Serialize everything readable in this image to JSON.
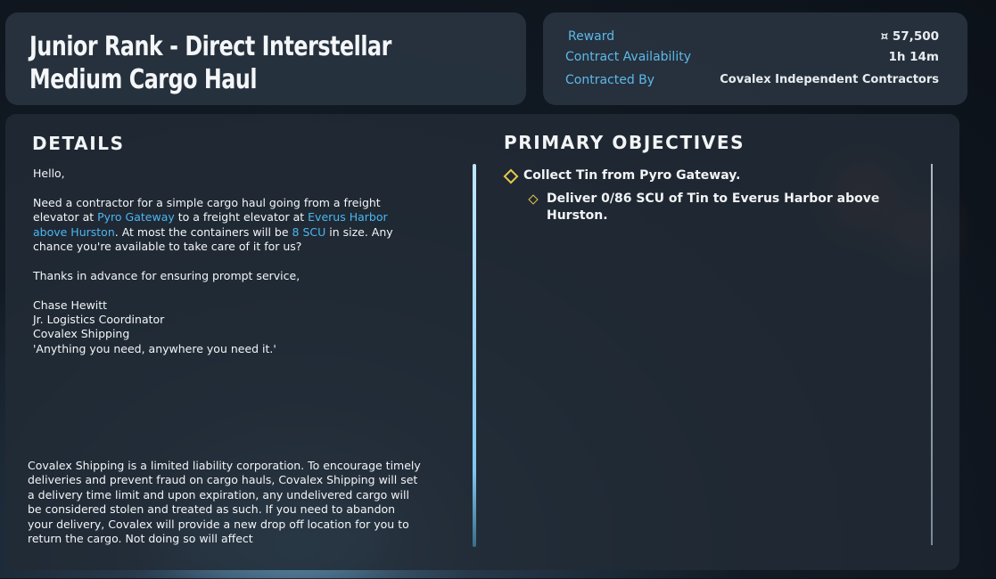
{
  "contract": {
    "title": "Junior Rank - Direct Interstellar Medium Cargo Haul"
  },
  "info": {
    "reward_label": "Reward",
    "reward_value": "¤ 57,500",
    "availability_label": "Contract Availability",
    "availability_value": "1h 14m",
    "contracted_by_label": "Contracted By",
    "contracted_by_value": "Covalex Independent Contractors"
  },
  "details": {
    "heading": "DETAILS",
    "greeting": "Hello,",
    "body_1": "Need a contractor for a simple cargo haul going from a freight elevator at ",
    "link_origin": "Pyro Gateway",
    "body_2": " to a freight elevator at ",
    "link_destination": "Everus Harbor above Hurston",
    "body_3": ". At most the containers will be ",
    "link_size": "8 SCU",
    "body_4": " in size. Any chance you're available to take care of it for us?",
    "thanks": "Thanks in advance for ensuring prompt service,",
    "signature_name": "Chase Hewitt",
    "signature_title": "Jr. Logistics Coordinator",
    "signature_company": "Covalex Shipping",
    "signature_motto": "'Anything you need, anywhere you need it.'",
    "disclaimer": "Covalex Shipping is a limited liability corporation. To encourage timely deliveries and prevent fraud on cargo hauls, Covalex Shipping will set a delivery time limit and upon expiration, any undelivered cargo will be considered stolen and treated as such. If you need to abandon your delivery, Covalex will provide a new drop off location for you to return the cargo. Not doing so will affect"
  },
  "objectives": {
    "heading": "PRIMARY OBJECTIVES",
    "primary": "Collect Tin from Pyro Gateway.",
    "secondary": "Deliver 0/86 SCU of Tin to Everus Harbor above Hurston."
  },
  "colors": {
    "accent_link": "#4cb6f2",
    "label_blue": "#5db8e8",
    "objective_marker": "#e8c94a"
  }
}
